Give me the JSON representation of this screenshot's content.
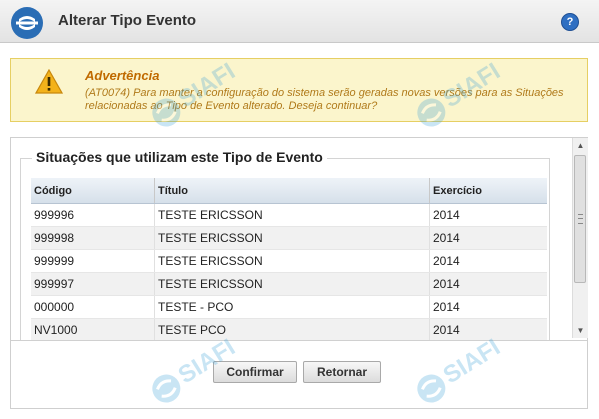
{
  "header": {
    "title": "Alterar Tipo Evento",
    "help_label": "?"
  },
  "warning": {
    "title": "Advertência",
    "message": "(AT0074) Para manter a configuração do sistema serão geradas novas versões para as Situações relacionadas ao Tipo de Evento alterado. Deseja continuar?"
  },
  "situations": {
    "legend": "Situações que utilizam este Tipo de Evento",
    "columns": [
      "Código",
      "Título",
      "Exercício"
    ],
    "rows": [
      {
        "codigo": "999996",
        "titulo": "TESTE ERICSSON",
        "exercicio": "2014"
      },
      {
        "codigo": "999998",
        "titulo": "TESTE ERICSSON",
        "exercicio": "2014"
      },
      {
        "codigo": "999999",
        "titulo": "TESTE ERICSSON",
        "exercicio": "2014"
      },
      {
        "codigo": "999997",
        "titulo": "TESTE ERICSSON",
        "exercicio": "2014"
      },
      {
        "codigo": "000000",
        "titulo": "TESTE - PCO",
        "exercicio": "2014"
      },
      {
        "codigo": "NV1000",
        "titulo": "TESTE PCO",
        "exercicio": "2014"
      }
    ]
  },
  "buttons": {
    "confirm": "Confirmar",
    "return": "Retornar"
  },
  "watermark_text": "SIAFI",
  "colors": {
    "warning_bg": "#fbf5cc",
    "warning_title": "#c06a00",
    "help_blue": "#2f6fc2"
  }
}
